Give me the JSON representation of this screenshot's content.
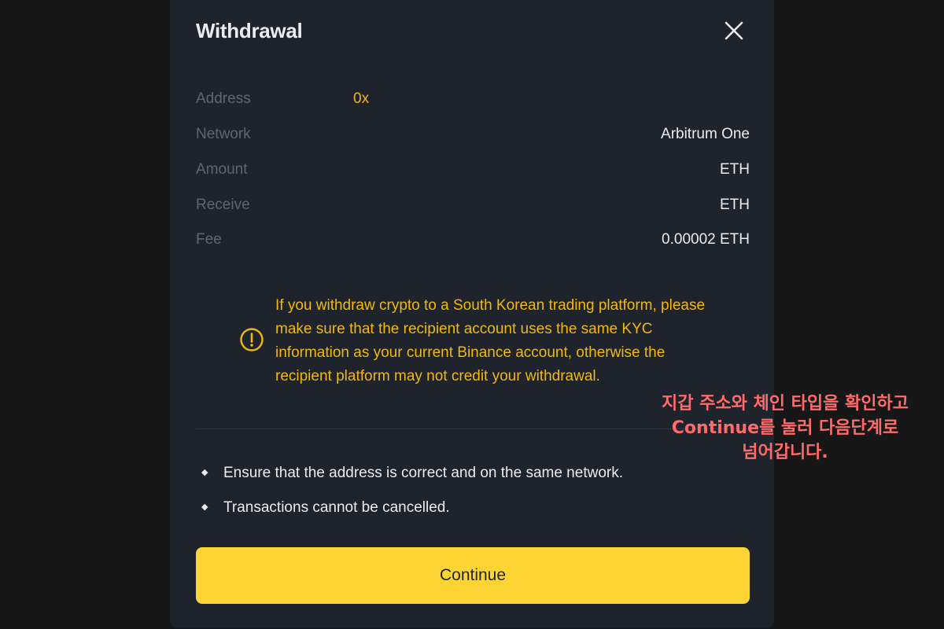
{
  "dialog": {
    "title": "Withdrawal",
    "close_icon": "close-icon"
  },
  "details": [
    {
      "label": "Address",
      "value": "0x"
    },
    {
      "label": "Network",
      "value": "Arbitrum One"
    },
    {
      "label": "Amount",
      "value": "ETH"
    },
    {
      "label": "Receive",
      "value": "ETH"
    },
    {
      "label": "Fee",
      "value": "0.00002 ETH"
    }
  ],
  "warning": {
    "icon": "warning-circle-icon",
    "text": "If you withdraw crypto to a South Korean trading platform, please make sure that the recipient account uses the same KYC information as your current Binance account, otherwise the recipient platform may not credit your withdrawal."
  },
  "notices": [
    "Ensure that the address is correct and on the same network.",
    "Transactions cannot be cancelled."
  ],
  "continue_label": "Continue",
  "annotation": {
    "line1": "지갑 주소와 체인 타입을 확인하고",
    "line2": "Continue를 눌러 다음단계로",
    "line3": "넘어갑니다."
  },
  "colors": {
    "accent": "#f0b90b",
    "button": "#fcd535",
    "annotation": "#ff6b6b"
  }
}
